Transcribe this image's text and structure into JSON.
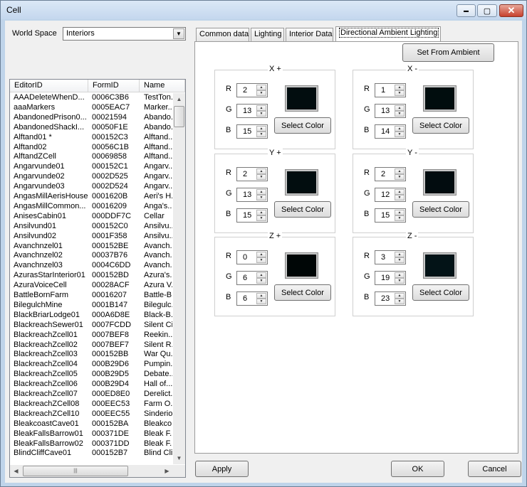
{
  "window": {
    "title": "Cell"
  },
  "title_buttons": {
    "minimize": "▬",
    "maximize": "▢",
    "close": "✕"
  },
  "world_space": {
    "label": "World Space",
    "value": "Interiors"
  },
  "list": {
    "columns": [
      "EditorID",
      "FormID",
      "Name"
    ],
    "rows": [
      [
        "AAADeleteWhenD...",
        "0006C3B6",
        "TestTon..."
      ],
      [
        "aaaMarkers",
        "0005EAC7",
        "Marker..."
      ],
      [
        "AbandonedPrison0...",
        "00021594",
        "Abando..."
      ],
      [
        "AbandonedShackI...",
        "00050F1E",
        "Abando..."
      ],
      [
        "Alftand01 *",
        "000152C3",
        "Alftand..."
      ],
      [
        "Alftand02",
        "00056C1B",
        "Alftand..."
      ],
      [
        "AlftandZCell",
        "00069858",
        "Alftand..."
      ],
      [
        "Angarvunde01",
        "000152C1",
        "Angarv..."
      ],
      [
        "Angarvunde02",
        "0002D525",
        "Angarv..."
      ],
      [
        "Angarvunde03",
        "0002D524",
        "Angarv..."
      ],
      [
        "AngasMillAerisHouse",
        "0001620B",
        "Aeri's H..."
      ],
      [
        "AngasMillCommon...",
        "00016209",
        "Anga's..."
      ],
      [
        "AnisesCabin01",
        "000DDF7C",
        "Cellar"
      ],
      [
        "Ansilvund01",
        "000152C0",
        "Ansilvu..."
      ],
      [
        "Ansilvund02",
        "0001F358",
        "Ansilvu..."
      ],
      [
        "Avanchnzel01",
        "000152BE",
        "Avanch..."
      ],
      [
        "Avanchnzel02",
        "00037B76",
        "Avanch..."
      ],
      [
        "Avanchnzel03",
        "0004C6DD",
        "Avanch..."
      ],
      [
        "AzurasStarInterior01",
        "000152BD",
        "Azura's..."
      ],
      [
        "AzuraVoiceCell",
        "00028ACF",
        "Azura V..."
      ],
      [
        "BattleBornFarm",
        "00016207",
        "Battle-B..."
      ],
      [
        "BilegulchMine",
        "0001B147",
        "Bilegulc..."
      ],
      [
        "BlackBriarLodge01",
        "000A6D8E",
        "Black-B..."
      ],
      [
        "BlackreachSewer01",
        "0007FCDD",
        "Silent Ci..."
      ],
      [
        "BlackreachZcell01",
        "0007BEF8",
        "Reekin..."
      ],
      [
        "BlackreachZcell02",
        "0007BEF7",
        "Silent R..."
      ],
      [
        "BlackreachZcell03",
        "000152BB",
        "War Qu..."
      ],
      [
        "BlackreachZcell04",
        "000B29D6",
        "Pumpin..."
      ],
      [
        "BlackreachZcell05",
        "000B29D5",
        "Debate..."
      ],
      [
        "BlackreachZcell06",
        "000B29D4",
        "Hall of..."
      ],
      [
        "BlackreachZcell07",
        "000ED8E0",
        "Derelict..."
      ],
      [
        "BlackreachZCell08",
        "000EEC53",
        "Farm O..."
      ],
      [
        "BlackreachZCell10",
        "000EEC55",
        "Sinderio..."
      ],
      [
        "BleakcoastCave01",
        "000152BA",
        "Bleakco..."
      ],
      [
        "BleakFallsBarrow01",
        "000371DE",
        "Bleak F..."
      ],
      [
        "BleakFallsBarrow02",
        "000371DD",
        "Bleak F..."
      ],
      [
        "BlindCliffCave01",
        "000152B7",
        "Blind Cli..."
      ]
    ]
  },
  "tabs": [
    "Common data",
    "Lighting",
    "Interior Data",
    "Directional Ambient Lighting"
  ],
  "set_from_ambient": "Set From Ambient",
  "groups": [
    {
      "title": "X +",
      "r": "2",
      "g": "13",
      "b": "15",
      "color": "#020d0f",
      "button": "Select Color"
    },
    {
      "title": "X -",
      "r": "1",
      "g": "13",
      "b": "14",
      "color": "#010d0e",
      "button": "Select Color"
    },
    {
      "title": "Y +",
      "r": "2",
      "g": "13",
      "b": "15",
      "color": "#020d0f",
      "button": "Select Color"
    },
    {
      "title": "Y -",
      "r": "2",
      "g": "12",
      "b": "15",
      "color": "#020c0f",
      "button": "Select Color"
    },
    {
      "title": "Z +",
      "r": "0",
      "g": "6",
      "b": "6",
      "color": "#000606",
      "button": "Select Color"
    },
    {
      "title": "Z -",
      "r": "3",
      "g": "19",
      "b": "23",
      "color": "#031317",
      "button": "Select Color"
    }
  ],
  "channel_labels": {
    "r": "R",
    "g": "G",
    "b": "B"
  },
  "spin_arrows": {
    "up": "▲",
    "down": "▼"
  },
  "footer": {
    "apply": "Apply",
    "ok": "OK",
    "cancel": "Cancel"
  },
  "scroll_arrows": {
    "up": "▲",
    "down": "▼",
    "left": "◀",
    "right": "▶",
    "grip": "|||",
    "dropdown": "▼"
  }
}
